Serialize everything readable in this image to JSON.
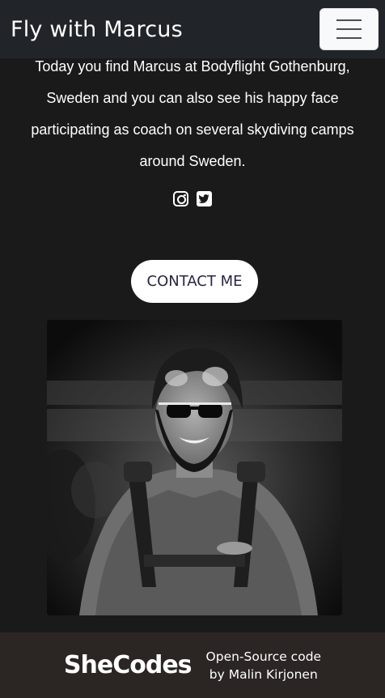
{
  "navbar": {
    "brand": "Fly with Marcus",
    "toggler_icon": "hamburger-menu-icon"
  },
  "about": {
    "lines": [
      "Today you find Marcus at Bodyflight Gothenburg,",
      "Sweden and you can also see his happy face",
      "participating as coach on several skydiving camps",
      "around Sweden."
    ]
  },
  "socials": {
    "icons": [
      "instagram-icon",
      "twitter-icon"
    ]
  },
  "contact": {
    "label": "CONTACT ME"
  },
  "photo": {
    "subject": "Marcus in skydiving helmet and sunglasses"
  },
  "footer": {
    "logo": "SheCodes",
    "credit_line1": "Open-Source code",
    "credit_line2": "by Malin Kirjonen"
  },
  "colors": {
    "page_bg": "#1b1a1b",
    "navbar_bg": "#212529",
    "footer_bg": "#2b2524",
    "button_text": "#2b2545"
  }
}
